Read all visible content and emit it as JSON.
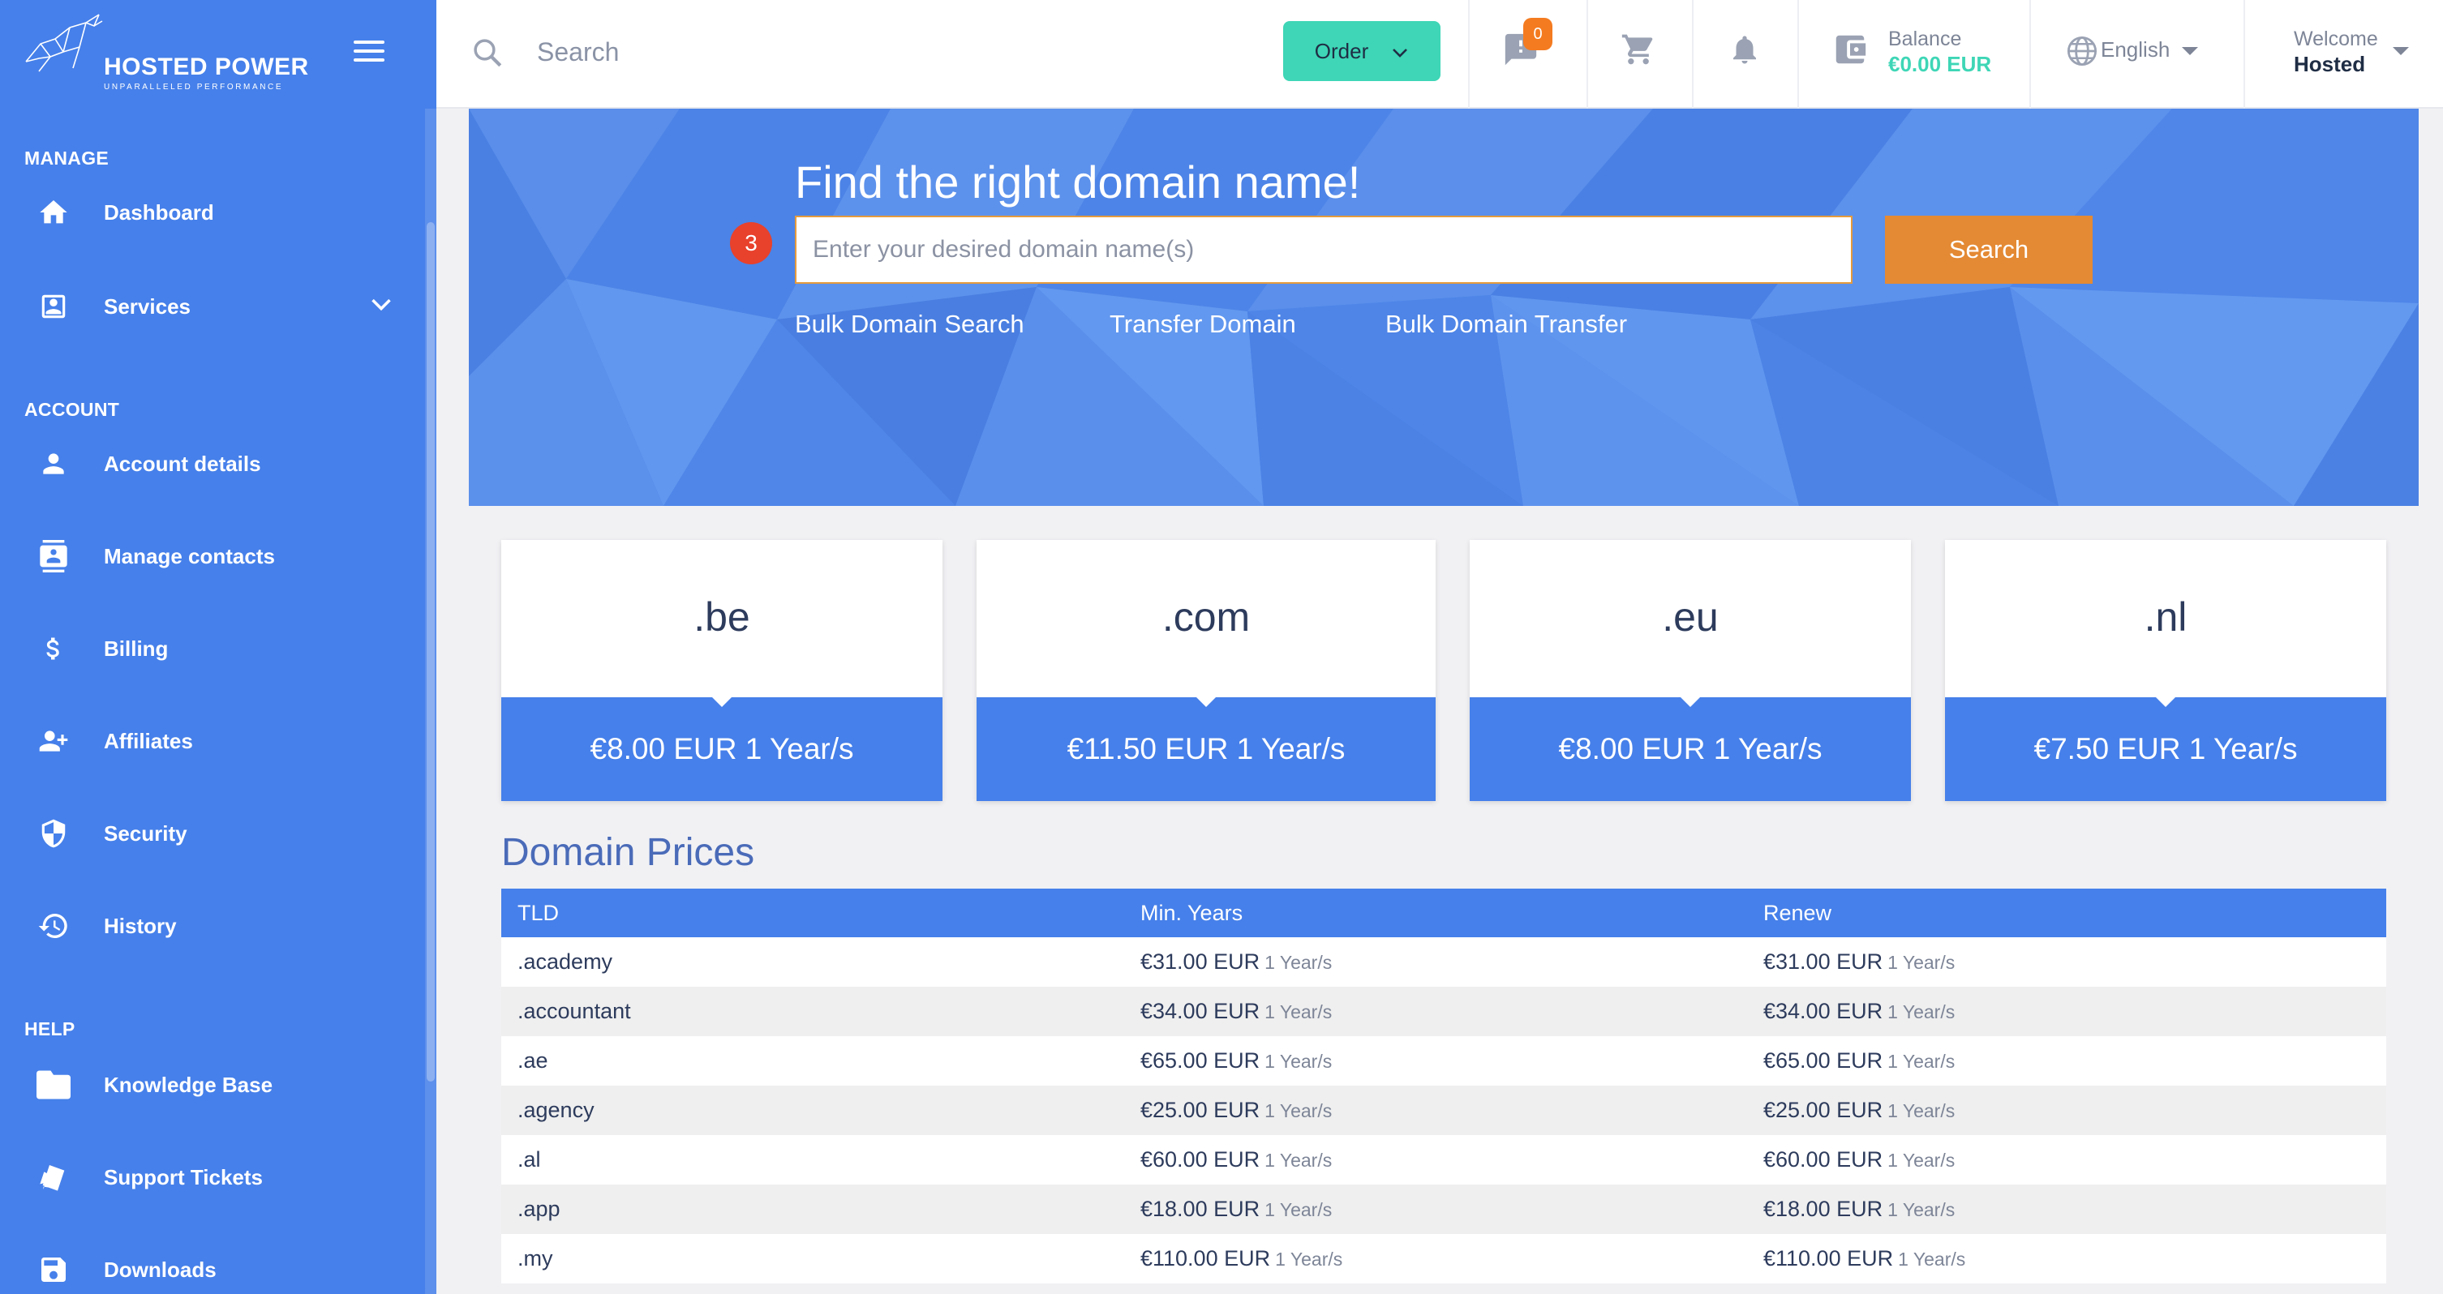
{
  "brand": {
    "name": "HOSTED POWER",
    "tagline": "UNPARALLELED PERFORMANCE"
  },
  "sidebar": {
    "sections": [
      {
        "label": "MANAGE",
        "items": [
          {
            "label": "Dashboard",
            "icon": "home-icon"
          },
          {
            "label": "Services",
            "icon": "id-card-icon"
          }
        ]
      },
      {
        "label": "ACCOUNT",
        "items": [
          {
            "label": "Account details",
            "icon": "user-icon"
          },
          {
            "label": "Manage contacts",
            "icon": "contacts-icon"
          },
          {
            "label": "Billing",
            "icon": "dollar-icon"
          },
          {
            "label": "Affiliates",
            "icon": "user-plus-icon"
          },
          {
            "label": "Security",
            "icon": "shield-icon"
          },
          {
            "label": "History",
            "icon": "history-icon"
          }
        ]
      },
      {
        "label": "HELP",
        "items": [
          {
            "label": "Knowledge Base",
            "icon": "folder-icon"
          },
          {
            "label": "Support Tickets",
            "icon": "tickets-icon"
          },
          {
            "label": "Downloads",
            "icon": "save-icon"
          }
        ]
      }
    ]
  },
  "topbar": {
    "search_placeholder": "Search",
    "order_label": "Order",
    "notifications_count": "0",
    "balance_label": "Balance",
    "balance_value": "€0.00 EUR",
    "language": "English",
    "welcome_label": "Welcome",
    "user_name": "Hosted"
  },
  "hero": {
    "title": "Find the right domain name!",
    "step_number": "3",
    "input_placeholder": "Enter your desired domain name(s)",
    "search_button": "Search",
    "links": [
      "Bulk Domain Search",
      "Transfer Domain",
      "Bulk Domain Transfer"
    ]
  },
  "featured_tlds": [
    {
      "tld": ".be",
      "price": "€8.00 EUR 1 Year/s"
    },
    {
      "tld": ".com",
      "price": "€11.50 EUR 1 Year/s"
    },
    {
      "tld": ".eu",
      "price": "€8.00 EUR 1 Year/s"
    },
    {
      "tld": ".nl",
      "price": "€7.50 EUR 1 Year/s"
    }
  ],
  "domain_prices": {
    "title": "Domain Prices",
    "columns": [
      "TLD",
      "Min. Years",
      "Renew"
    ],
    "rows": [
      {
        "tld": ".academy",
        "min_price": "€31.00 EUR",
        "min_years": "1 Year/s",
        "renew_price": "€31.00 EUR",
        "renew_years": "1 Year/s"
      },
      {
        "tld": ".accountant",
        "min_price": "€34.00 EUR",
        "min_years": "1 Year/s",
        "renew_price": "€34.00 EUR",
        "renew_years": "1 Year/s"
      },
      {
        "tld": ".ae",
        "min_price": "€65.00 EUR",
        "min_years": "1 Year/s",
        "renew_price": "€65.00 EUR",
        "renew_years": "1 Year/s"
      },
      {
        "tld": ".agency",
        "min_price": "€25.00 EUR",
        "min_years": "1 Year/s",
        "renew_price": "€25.00 EUR",
        "renew_years": "1 Year/s"
      },
      {
        "tld": ".al",
        "min_price": "€60.00 EUR",
        "min_years": "1 Year/s",
        "renew_price": "€60.00 EUR",
        "renew_years": "1 Year/s"
      },
      {
        "tld": ".app",
        "min_price": "€18.00 EUR",
        "min_years": "1 Year/s",
        "renew_price": "€18.00 EUR",
        "renew_years": "1 Year/s"
      },
      {
        "tld": ".my",
        "min_price": "€110.00 EUR",
        "min_years": "1 Year/s",
        "renew_price": "€110.00 EUR",
        "renew_years": "1 Year/s"
      }
    ]
  },
  "colors": {
    "primary": "#4680ea",
    "accent_green": "#3ed6b6",
    "accent_orange": "#e48a34",
    "badge_orange": "#f47b20",
    "step_red": "#e8412c"
  }
}
